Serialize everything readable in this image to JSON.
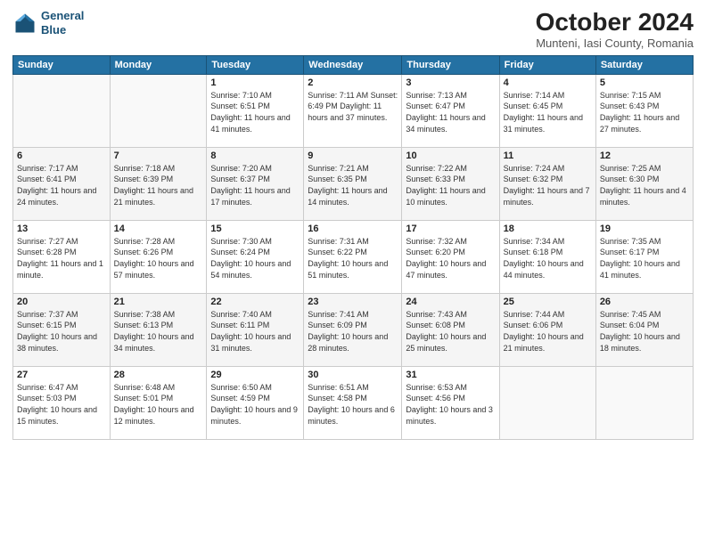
{
  "header": {
    "logo_line1": "General",
    "logo_line2": "Blue",
    "month_title": "October 2024",
    "location": "Munteni, Iasi County, Romania"
  },
  "days_of_week": [
    "Sunday",
    "Monday",
    "Tuesday",
    "Wednesday",
    "Thursday",
    "Friday",
    "Saturday"
  ],
  "weeks": [
    [
      {
        "day": "",
        "info": ""
      },
      {
        "day": "",
        "info": ""
      },
      {
        "day": "1",
        "info": "Sunrise: 7:10 AM\nSunset: 6:51 PM\nDaylight: 11 hours and 41 minutes."
      },
      {
        "day": "2",
        "info": "Sunrise: 7:11 AM\nSunset: 6:49 PM\nDaylight: 11 hours and 37 minutes."
      },
      {
        "day": "3",
        "info": "Sunrise: 7:13 AM\nSunset: 6:47 PM\nDaylight: 11 hours and 34 minutes."
      },
      {
        "day": "4",
        "info": "Sunrise: 7:14 AM\nSunset: 6:45 PM\nDaylight: 11 hours and 31 minutes."
      },
      {
        "day": "5",
        "info": "Sunrise: 7:15 AM\nSunset: 6:43 PM\nDaylight: 11 hours and 27 minutes."
      }
    ],
    [
      {
        "day": "6",
        "info": "Sunrise: 7:17 AM\nSunset: 6:41 PM\nDaylight: 11 hours and 24 minutes."
      },
      {
        "day": "7",
        "info": "Sunrise: 7:18 AM\nSunset: 6:39 PM\nDaylight: 11 hours and 21 minutes."
      },
      {
        "day": "8",
        "info": "Sunrise: 7:20 AM\nSunset: 6:37 PM\nDaylight: 11 hours and 17 minutes."
      },
      {
        "day": "9",
        "info": "Sunrise: 7:21 AM\nSunset: 6:35 PM\nDaylight: 11 hours and 14 minutes."
      },
      {
        "day": "10",
        "info": "Sunrise: 7:22 AM\nSunset: 6:33 PM\nDaylight: 11 hours and 10 minutes."
      },
      {
        "day": "11",
        "info": "Sunrise: 7:24 AM\nSunset: 6:32 PM\nDaylight: 11 hours and 7 minutes."
      },
      {
        "day": "12",
        "info": "Sunrise: 7:25 AM\nSunset: 6:30 PM\nDaylight: 11 hours and 4 minutes."
      }
    ],
    [
      {
        "day": "13",
        "info": "Sunrise: 7:27 AM\nSunset: 6:28 PM\nDaylight: 11 hours and 1 minute."
      },
      {
        "day": "14",
        "info": "Sunrise: 7:28 AM\nSunset: 6:26 PM\nDaylight: 10 hours and 57 minutes."
      },
      {
        "day": "15",
        "info": "Sunrise: 7:30 AM\nSunset: 6:24 PM\nDaylight: 10 hours and 54 minutes."
      },
      {
        "day": "16",
        "info": "Sunrise: 7:31 AM\nSunset: 6:22 PM\nDaylight: 10 hours and 51 minutes."
      },
      {
        "day": "17",
        "info": "Sunrise: 7:32 AM\nSunset: 6:20 PM\nDaylight: 10 hours and 47 minutes."
      },
      {
        "day": "18",
        "info": "Sunrise: 7:34 AM\nSunset: 6:18 PM\nDaylight: 10 hours and 44 minutes."
      },
      {
        "day": "19",
        "info": "Sunrise: 7:35 AM\nSunset: 6:17 PM\nDaylight: 10 hours and 41 minutes."
      }
    ],
    [
      {
        "day": "20",
        "info": "Sunrise: 7:37 AM\nSunset: 6:15 PM\nDaylight: 10 hours and 38 minutes."
      },
      {
        "day": "21",
        "info": "Sunrise: 7:38 AM\nSunset: 6:13 PM\nDaylight: 10 hours and 34 minutes."
      },
      {
        "day": "22",
        "info": "Sunrise: 7:40 AM\nSunset: 6:11 PM\nDaylight: 10 hours and 31 minutes."
      },
      {
        "day": "23",
        "info": "Sunrise: 7:41 AM\nSunset: 6:09 PM\nDaylight: 10 hours and 28 minutes."
      },
      {
        "day": "24",
        "info": "Sunrise: 7:43 AM\nSunset: 6:08 PM\nDaylight: 10 hours and 25 minutes."
      },
      {
        "day": "25",
        "info": "Sunrise: 7:44 AM\nSunset: 6:06 PM\nDaylight: 10 hours and 21 minutes."
      },
      {
        "day": "26",
        "info": "Sunrise: 7:45 AM\nSunset: 6:04 PM\nDaylight: 10 hours and 18 minutes."
      }
    ],
    [
      {
        "day": "27",
        "info": "Sunrise: 6:47 AM\nSunset: 5:03 PM\nDaylight: 10 hours and 15 minutes."
      },
      {
        "day": "28",
        "info": "Sunrise: 6:48 AM\nSunset: 5:01 PM\nDaylight: 10 hours and 12 minutes."
      },
      {
        "day": "29",
        "info": "Sunrise: 6:50 AM\nSunset: 4:59 PM\nDaylight: 10 hours and 9 minutes."
      },
      {
        "day": "30",
        "info": "Sunrise: 6:51 AM\nSunset: 4:58 PM\nDaylight: 10 hours and 6 minutes."
      },
      {
        "day": "31",
        "info": "Sunrise: 6:53 AM\nSunset: 4:56 PM\nDaylight: 10 hours and 3 minutes."
      },
      {
        "day": "",
        "info": ""
      },
      {
        "day": "",
        "info": ""
      }
    ]
  ]
}
